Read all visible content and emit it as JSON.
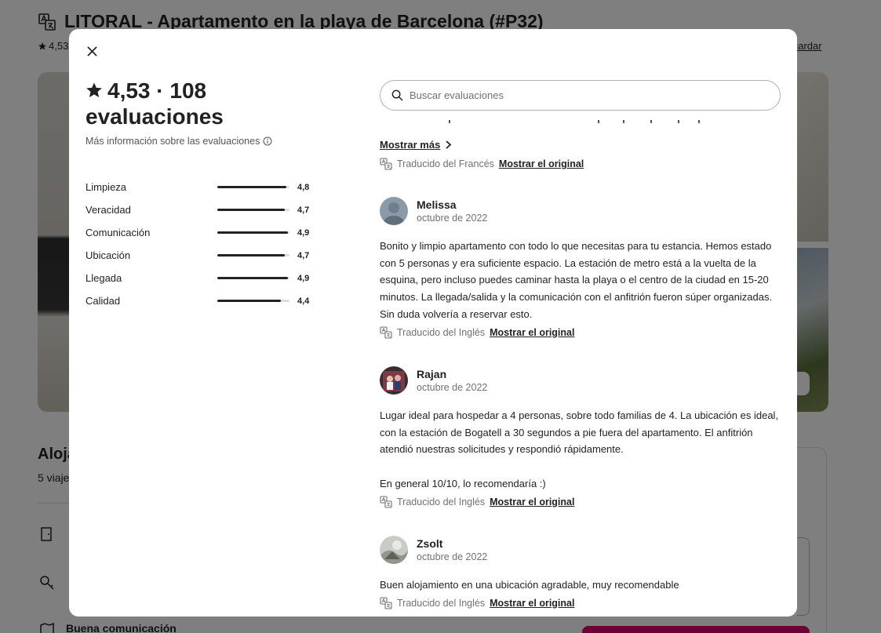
{
  "background": {
    "title": "LITORAL - Apartamento en la playa de Barcelona (#P32)",
    "rating_partial": "4,53",
    "save_partial": "uardar",
    "host_partial": "Aloja",
    "guests_partial": "5 viaje",
    "amenity_text": "Buena comunicación"
  },
  "modal": {
    "rating_line": "4,53 · 108",
    "reviews_word": "evaluaciones",
    "more_info": "Más información sobre las evaluaciones",
    "categories": [
      {
        "label": "Limpieza",
        "value": "4,8",
        "score": 4.8
      },
      {
        "label": "Veracidad",
        "value": "4,7",
        "score": 4.7
      },
      {
        "label": "Comunicación",
        "value": "4,9",
        "score": 4.9
      },
      {
        "label": "Ubicación",
        "value": "4,7",
        "score": 4.7
      },
      {
        "label": "Llegada",
        "value": "4,9",
        "score": 4.9
      },
      {
        "label": "Calidad",
        "value": "4,4",
        "score": 4.4
      }
    ],
    "search_placeholder": "Buscar evaluaciones",
    "prev_review": {
      "show_more": "Mostrar más",
      "translated_from": "Traducido del Francés",
      "show_original": "Mostrar el original"
    },
    "reviews": [
      {
        "name": "Melissa",
        "date": "octubre de 2022",
        "text": "Bonito y limpio apartamento con todo lo que necesitas para tu estancia. Hemos estado con 5 personas y era suficiente espacio. La estación de metro está a la vuelta de la esquina, pero incluso puedes caminar hasta la playa o el centro de la ciudad en 15-20 minutos. La llegada/salida y la comunicación con el anfitrión fueron súper organizadas. Sin duda volvería a reservar esto.",
        "translated_from": "Traducido del Inglés",
        "show_original": "Mostrar el original"
      },
      {
        "name": "Rajan",
        "date": "octubre de 2022",
        "text": "Lugar ideal para hospedar a 4 personas, sobre todo familias de 4. La ubicación es ideal, con la estación de Bogatell a 30 segundos a pie fuera del apartamento. El anfitrión atendió nuestras solicitudes y respondió rápidamente.\n\nEn general 10/10, lo recomendaría :)",
        "translated_from": "Traducido del Inglés",
        "show_original": "Mostrar el original"
      },
      {
        "name": "Zsolt",
        "date": "octubre de 2022",
        "text": "Buen alojamiento en una ubicación agradable, muy recomendable",
        "translated_from": "Traducido del Inglés",
        "show_original": "Mostrar el original"
      }
    ]
  }
}
